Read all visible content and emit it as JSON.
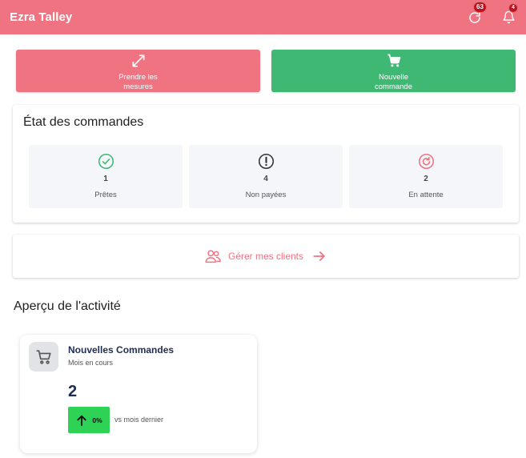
{
  "header": {
    "title": "Ezra Talley",
    "sync_badge": "63",
    "notification_badge": "4"
  },
  "actions": {
    "measure_label": "Prendre les mesures",
    "order_label": "Nouvelle commande"
  },
  "status": {
    "title": "État des commandes",
    "items": [
      {
        "value": "1",
        "label": "Prêtes",
        "icon": "check-circle-icon",
        "color": "#3fb874"
      },
      {
        "value": "4",
        "label": "Non payées",
        "icon": "alert-circle-icon",
        "color": "#333333"
      },
      {
        "value": "2",
        "label": "En attente",
        "icon": "refresh-circle-icon",
        "color": "#f07382"
      }
    ]
  },
  "clients": {
    "label": "Gérer mes clients"
  },
  "activity": {
    "section_title": "Aperçu de l'activité",
    "card": {
      "title": "Nouvelles Commandes",
      "subtitle": "Mois en cours",
      "value": "2",
      "trend_percent": "0%",
      "trend_note": "vs mois dernier"
    }
  },
  "colors": {
    "primary": "#f07382",
    "success": "#3fb874",
    "trend_green": "#2ed255",
    "badge_red": "#c0121e"
  }
}
